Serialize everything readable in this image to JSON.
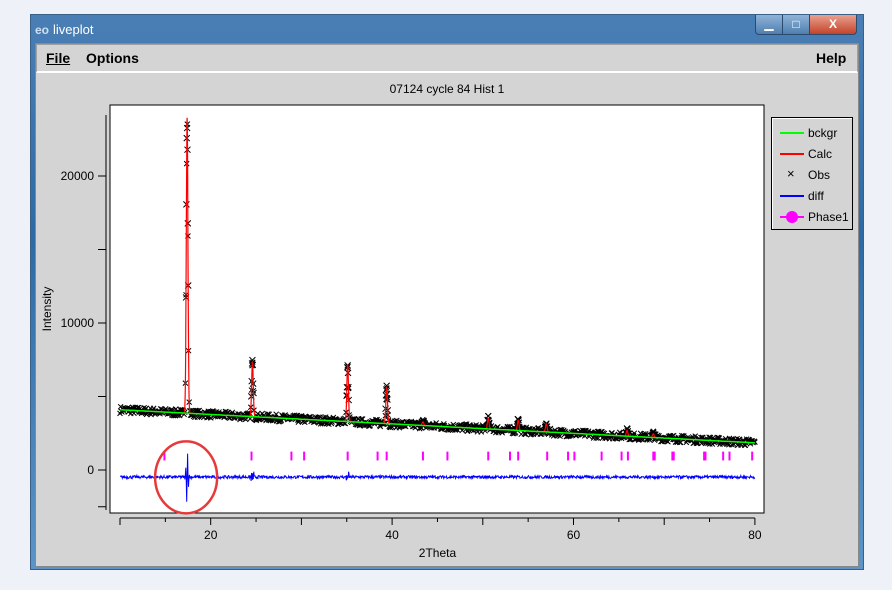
{
  "window": {
    "title": "liveplot",
    "app_icon": "eo",
    "minimize": "▁",
    "maximize": "□",
    "close": "X"
  },
  "menu": {
    "file": "File",
    "options": "Options",
    "help": "Help"
  },
  "chart_data": {
    "type": "line",
    "title": "07124 cycle 84 Hist 1",
    "xlabel": "2Theta",
    "ylabel": "Intensity",
    "xlim": [
      9,
      81
    ],
    "ylim": [
      -3000,
      24800
    ],
    "xticks": [
      20,
      40,
      60,
      80
    ],
    "xtick_labels": [
      "20",
      "40",
      "60",
      "80"
    ],
    "yticks": [
      0,
      10000,
      20000
    ],
    "ytick_labels": [
      "0",
      "10000",
      "20000"
    ],
    "legend": {
      "placement": "right-outside",
      "entries": [
        "bckgr",
        "Calc",
        "Obs",
        "diff",
        "Phase1"
      ]
    },
    "colors": {
      "bckgr": "#00ff00",
      "Calc": "#ff0000",
      "Obs": "#000000",
      "diff": "#0000ff",
      "Phase1": "#ff00ff"
    },
    "background": {
      "start": [
        10,
        4100
      ],
      "end": [
        80,
        1850
      ]
    },
    "peaks": [
      {
        "pos": 17.4,
        "height": 20100
      },
      {
        "pos": 24.6,
        "height": 3700
      },
      {
        "pos": 35.1,
        "height": 3900
      },
      {
        "pos": 39.4,
        "height": 2500
      },
      {
        "pos": 43.4,
        "height": 250
      },
      {
        "pos": 50.6,
        "height": 700
      },
      {
        "pos": 53.9,
        "height": 700
      },
      {
        "pos": 57.0,
        "height": 550
      },
      {
        "pos": 65.9,
        "height": 400
      },
      {
        "pos": 68.8,
        "height": 250
      }
    ],
    "diff_offset": -480,
    "phase1_reflections": [
      14.9,
      24.5,
      28.9,
      30.3,
      35.1,
      38.4,
      39.4,
      43.4,
      46.1,
      50.6,
      53.0,
      53.9,
      57.1,
      59.4,
      60.1,
      63.1,
      65.3,
      66.0,
      68.8,
      68.95,
      70.9,
      71.05,
      74.4,
      74.55,
      76.5,
      77.2,
      79.7
    ],
    "annotation": "red circle around diff at 2Theta ≈ 17.4"
  }
}
